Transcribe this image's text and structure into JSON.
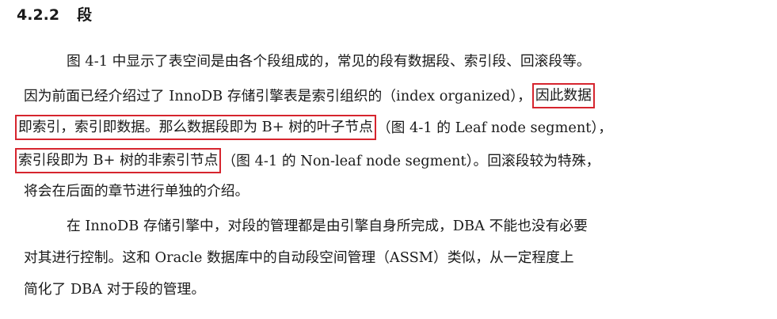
{
  "section": {
    "number": "4.2.2",
    "title": "段"
  },
  "paragraph1": {
    "line1": "图 4-1 中显示了表空间是由各个段组成的，常见的段有数据段、索引段、回滚段等。",
    "line2_pre": "因为前面已经介绍过了 InnoDB 存储引擎表是索引组织的（index organized），",
    "line2_hl": "因此数据",
    "line3_hl": "即索引，索引即数据。那么数据段即为 B+ 树的叶子节点",
    "line3_post": "（图 4-1 的 Leaf node segment），",
    "line4_hl": "索引段即为 B+ 树的非索引节点",
    "line4_post": "（图 4-1 的 Non-leaf node segment）。回滚段较为特殊，",
    "line5": "将会在后面的章节进行单独的介绍。"
  },
  "paragraph2": {
    "line1": "在 InnoDB 存储引擎中，对段的管理都是由引擎自身所完成，DBA 不能也没有必要",
    "line2": "对其进行控制。这和 Oracle 数据库中的自动段空间管理（ASSM）类似，从一定程度上",
    "line3": "简化了 DBA 对于段的管理。"
  },
  "colors": {
    "highlight_border": "#d6252e",
    "text": "#1a1a1a"
  }
}
